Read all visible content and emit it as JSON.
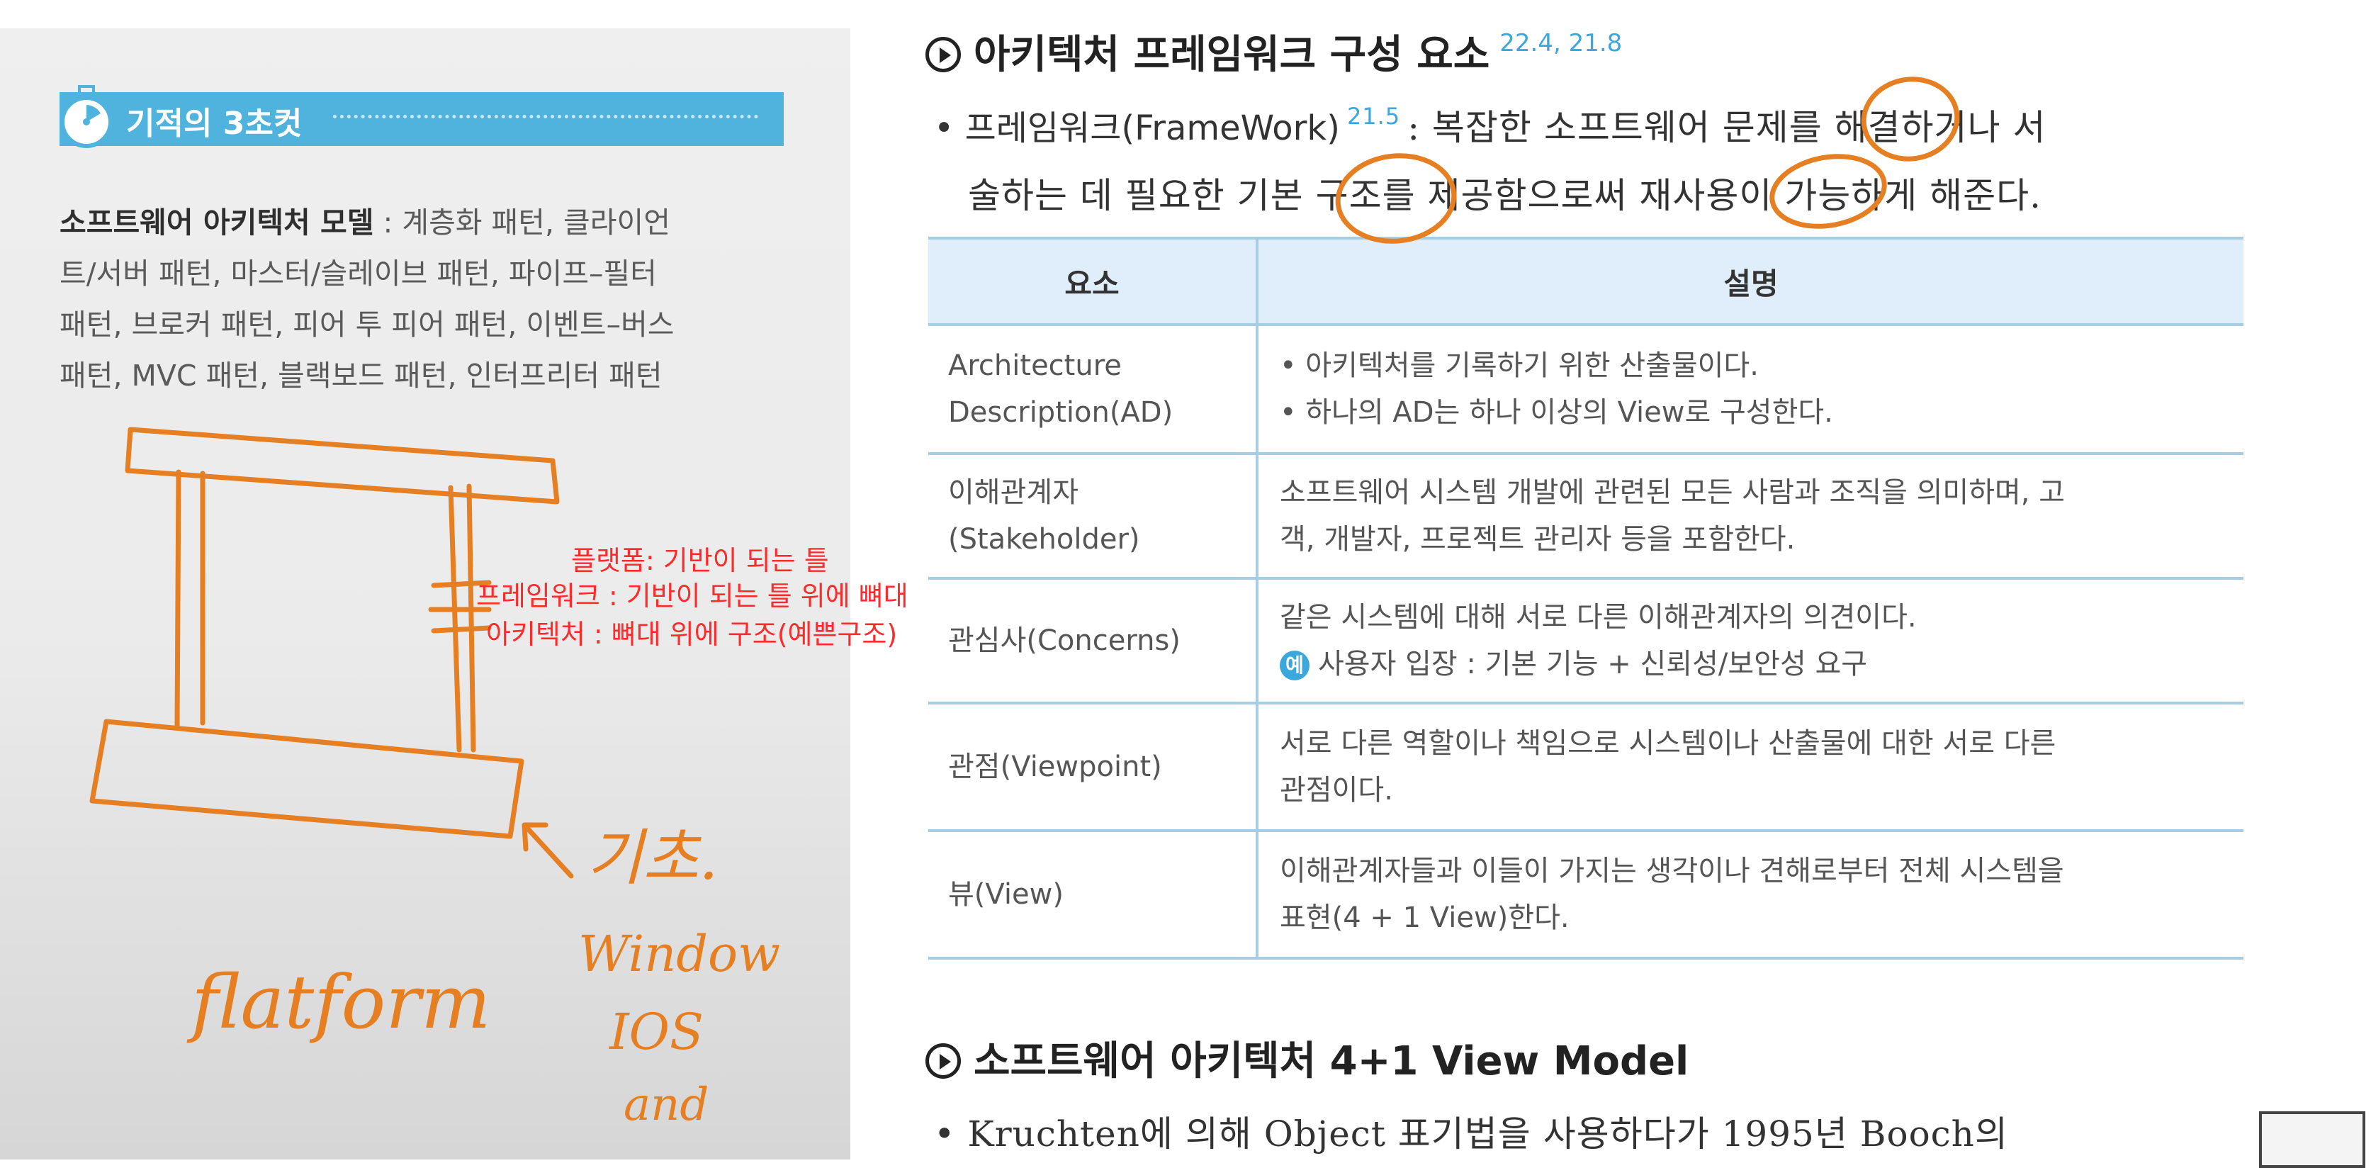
{
  "tip": {
    "title": "기적의 3초컷",
    "term": "소프트웨어 아키텍처 모델",
    "line1_rest": " : 계층화 패턴, 클라이언",
    "line2": "트/서버 패턴, 마스터/슬레이브 패턴, 파이프–필터",
    "line3": "패턴, 브로커 패턴, 피어 투 피어 패턴, 이벤트–버스",
    "line4": "패턴, MVC 패턴, 블랙보드 패턴, 인터프리터 패턴"
  },
  "notes": {
    "n1": "플랫폼: 기반이 되는 틀",
    "n2": "프레임워크 : 기반이 되는 틀 위에 뼈대",
    "n3": "아키텍처 : 뼈대 위에 구조(예쁜구조)"
  },
  "handwriting": {
    "w1": "기초.",
    "w2": "Window",
    "w3": "IOS",
    "w4": "and",
    "w5": "flatform"
  },
  "section1": {
    "title": "아키텍처 프레임워크 구성 요소",
    "refs": "22.4, 21.8",
    "def_lead": "• 프레임워크(FrameWork)",
    "def_ref": "21.5",
    "def_line1_rest": ": 복잡한 소프트웨어 문제를 해결하거나 서",
    "def_line2": "술하는 데 필요한 기본 구조를 제공함으로써 재사용이 가능하게 해준다."
  },
  "table": {
    "headers": [
      "요소",
      "설명"
    ],
    "rows": [
      {
        "name1": "Architecture",
        "name2": "Description(AD)",
        "d1": "• 아키텍처를 기록하기 위한 산출물이다.",
        "d2": "• 하나의 AD는 하나 이상의 View로 구성한다."
      },
      {
        "name1": "이해관계자",
        "name2": "(Stakeholder)",
        "d1": "소프트웨어 시스템 개발에 관련된 모든 사람과 조직을 의미하며, 고",
        "d2": "객, 개발자, 프로젝트 관리자 등을 포함한다."
      },
      {
        "name1": "관심사(Concerns)",
        "name2": "",
        "d1": "같은 시스템에 대해 서로 다른 이해관계자의 의견이다.",
        "badge": "예",
        "d2": "사용자 입장 : 기본 기능 + 신뢰성/보안성 요구"
      },
      {
        "name1": "관점(Viewpoint)",
        "name2": "",
        "d1": "서로 다른 역할이나 책임으로 시스템이나 산출물에 대한 서로 다른",
        "d2": "관점이다."
      },
      {
        "name1": "뷰(View)",
        "name2": "",
        "d1": "이해관계자들과 이들이 가지는 생각이나 견해로부터 전체 시스템을",
        "d2": "표현(4 + 1 View)한다."
      }
    ]
  },
  "section2": {
    "title": "소프트웨어 아키텍처 4+1 View Model",
    "line1": "• Kruchten에 의해 Object 표기법을 사용하다가 1995년 Booch의"
  },
  "colors": {
    "accent": "#4fb3de",
    "annotation": "#e67e22",
    "note_red": "#ff2a2a",
    "table_header": "#dfeefa"
  }
}
